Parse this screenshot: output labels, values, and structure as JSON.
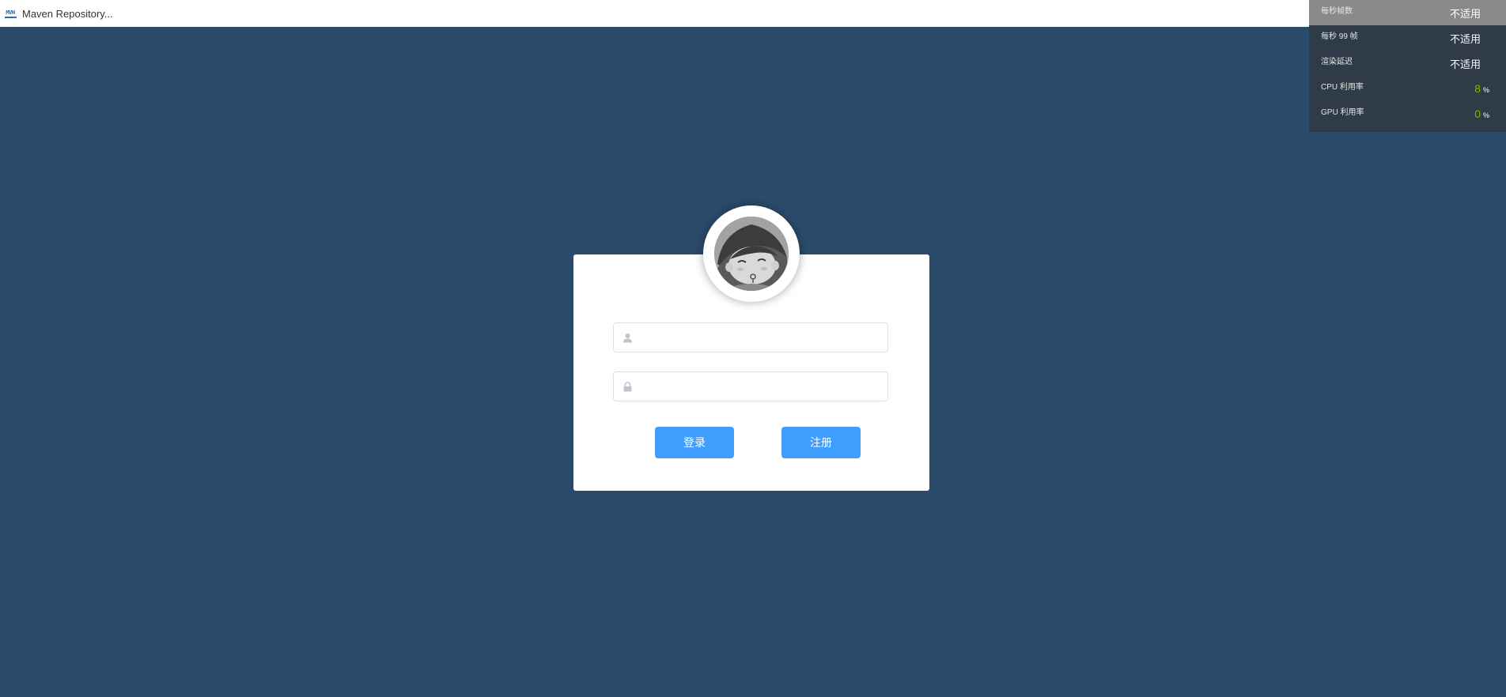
{
  "tab": {
    "icon": "maven-icon",
    "icon_text": "MVN",
    "title": "Maven Repository..."
  },
  "perf_overlay": {
    "rows": [
      {
        "label": "每秒帧数",
        "value": "不适用"
      },
      {
        "label": "每秒 99 帧",
        "value": "不适用"
      },
      {
        "label": "渲染延迟",
        "value": "不适用"
      },
      {
        "label": "CPU 利用率",
        "value": "8",
        "unit": "%"
      },
      {
        "label": "GPU 利用率",
        "value": "0",
        "unit": "%"
      }
    ],
    "accent_color": "#76b900"
  },
  "login": {
    "avatar": "avatar-icon",
    "username": {
      "icon": "user-icon",
      "value": "",
      "placeholder": ""
    },
    "password": {
      "icon": "lock-icon",
      "value": "",
      "placeholder": ""
    },
    "login_label": "登录",
    "register_label": "注册",
    "button_color": "#409eff"
  },
  "colors": {
    "background": "#2b4b6b",
    "card": "#ffffff"
  }
}
